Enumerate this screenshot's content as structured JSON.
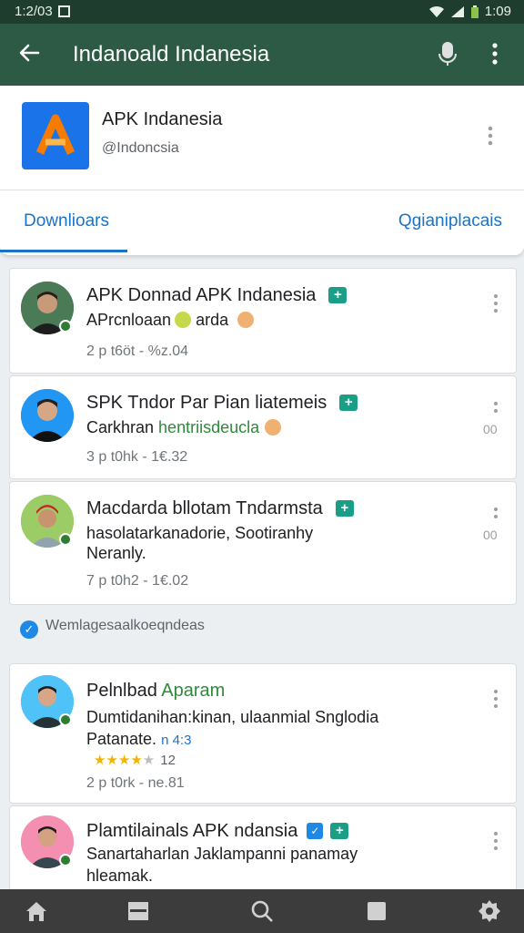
{
  "status": {
    "left": "1:2/03",
    "right": "1:09"
  },
  "appbar": {
    "title": "Indanoald Indanesia"
  },
  "header": {
    "app_name": "APK Indanesia",
    "handle": "@Indoncsia",
    "tab_left": "Downlioars",
    "tab_right": "Qgianiplacais"
  },
  "posts": [
    {
      "title": "APK Donnad APK Indanesia",
      "line1": "APrcnloaan",
      "line1b": "arda",
      "meta": "2 p t6öt - %z.04"
    },
    {
      "title": "SPK Tndor Par Pian liatemeis",
      "line1": "Carkhran",
      "line1_green": "hentriisdeucla",
      "meta": "3 p t0hk - 1€.32",
      "count": "00"
    },
    {
      "title": "Macdarda bllotam Tndarmsta",
      "line1": "hasolatarkanadorie, Sootiranhy",
      "line2": "Neranly.",
      "meta": "7 p t0h2 - 1€.02",
      "count": "00"
    },
    {
      "title": "Pelnlbad",
      "title_green": "Aparam",
      "line1": "Dumtidanihan:kinan, ulaanmial Snglodia",
      "line2": "Patanate.",
      "line2_blue": "n 4:3",
      "rating": "12",
      "meta": "2 p t0rk - ne.81"
    },
    {
      "title": "Plamtilainals APK ndansia",
      "line1": "Sanartaharlan Jaklampanni panamay",
      "line2": "hleamak."
    }
  ],
  "section": {
    "label": "Wemlagesaalkoeqndeas"
  },
  "colors": {
    "appbar": "#2c5a45",
    "status": "#1e3d2f",
    "accent": "#1a73c8",
    "badge": "#1a9e86",
    "online": "#2e7d32",
    "bottom_nav": "#3c3c3c"
  },
  "icons": [
    "back-arrow-icon",
    "mic-icon",
    "more-vert-icon",
    "app-logo-icon",
    "add-badge-icon",
    "home-icon",
    "library-icon",
    "search-icon",
    "square-icon",
    "settings-icon"
  ]
}
